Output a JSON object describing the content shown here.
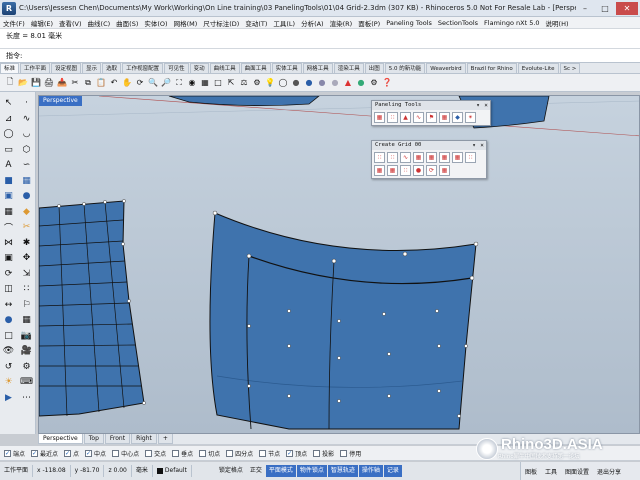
{
  "window": {
    "title": "C:\\Users\\Jessesn Chen\\Documents\\My Work\\Working\\On Line training\\03 PanelingTools\\01\\04 Grid-2.3dm (307 KB) - Rhinoceros 5.0 Not For Resale Lab - [Perspective]",
    "icon": "rhino-app-icon"
  },
  "menubar": [
    "文件(F)",
    "编辑(E)",
    "查看(V)",
    "曲线(C)",
    "曲面(S)",
    "实体(O)",
    "网格(M)",
    "尺寸标注(D)",
    "变动(T)",
    "工具(L)",
    "分析(A)",
    "渲染(R)",
    "面板(P)",
    "Paneling Tools",
    "SectionTools",
    "Flamingo nXt 5.0",
    "说明(H)"
  ],
  "command": {
    "history": "长度 = 8.01 毫米",
    "prompt_label": "指令:",
    "input_value": ""
  },
  "tabs": [
    "标准",
    "工作平面",
    "设定视图",
    "显示",
    "选取",
    "工作视窗配置",
    "可见性",
    "变动",
    "曲线工具",
    "曲面工具",
    "实体工具",
    "网格工具",
    "渲染工具",
    "出图",
    "5.0 的新功能",
    "Weaverbird",
    "Brazil for Rhino",
    "Evolute-Lite",
    "Sc >"
  ],
  "viewport": {
    "label": "Perspective",
    "tabs": [
      "Perspective",
      "Top",
      "Front",
      "Right"
    ],
    "active_tab": "Perspective",
    "add_tab_icon": "plus-icon"
  },
  "float_toolbars": {
    "paneling": {
      "title": "Paneling Tools"
    },
    "create_grid": {
      "title": "Create Grid 00"
    }
  },
  "osnap": [
    {
      "label": "端点",
      "checked": true
    },
    {
      "label": "最近点",
      "checked": true
    },
    {
      "label": "点",
      "checked": true
    },
    {
      "label": "中点",
      "checked": true
    },
    {
      "label": "中心点",
      "checked": false
    },
    {
      "label": "交点",
      "checked": false
    },
    {
      "label": "垂点",
      "checked": false
    },
    {
      "label": "切点",
      "checked": false
    },
    {
      "label": "四分点",
      "checked": false
    },
    {
      "label": "节点",
      "checked": false
    },
    {
      "label": "顶点",
      "checked": true
    },
    {
      "label": "投影",
      "checked": false
    },
    {
      "label": "停用",
      "checked": false
    }
  ],
  "status": {
    "cplane": "工作平面",
    "x": "x -118.08",
    "y": "y -81.70",
    "z": "z 0.00",
    "unit": "毫米",
    "layer": "Default",
    "buttons": [
      {
        "label": "锁定格点",
        "on": false
      },
      {
        "label": "正交",
        "on": false
      },
      {
        "label": "平面模式",
        "on": true
      },
      {
        "label": "物件锁点",
        "on": true
      },
      {
        "label": "智慧轨迹",
        "on": true
      },
      {
        "label": "操作轴",
        "on": true
      },
      {
        "label": "记录",
        "on": true
      }
    ],
    "right_items": [
      "图板",
      "工具",
      "图面设置",
      "退出分享"
    ]
  },
  "watermark": {
    "text": "Rhino3D.ASIA",
    "sub": "Rhino犀牛中国技术支持第一论坛"
  },
  "colors": {
    "surface": "#3f73ad",
    "surface_dark": "#2b5a8f",
    "viewport_bg": "#b4c2d0",
    "accent": "#3a6fc4"
  }
}
